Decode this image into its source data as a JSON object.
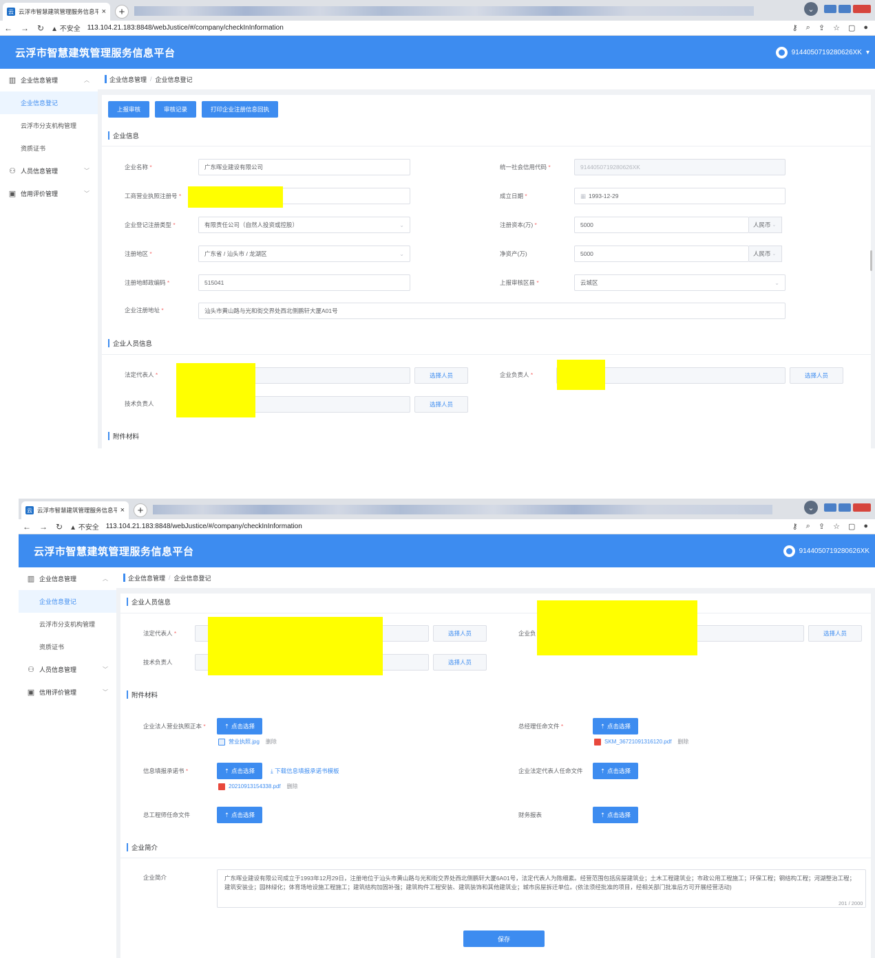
{
  "browser": {
    "tab_title": "云浮市智慧建筑管理服务信息平",
    "tab_close": "×",
    "new_tab": "+",
    "insecure": "▲ 不安全",
    "url": "113.104.21.183:8848/webJustice/#/company/checkInInformation"
  },
  "app": {
    "title": "云浮市智慧建筑管理服务信息平台",
    "user_id": "9144050719280626XK"
  },
  "sidebar": {
    "group_company": "企业信息管理",
    "item_register": "企业信息登记",
    "item_branch": "云浮市分支机构管理",
    "item_cert": "资质证书",
    "group_person": "人员信息管理",
    "group_credit": "信用评价管理"
  },
  "breadcrumb": {
    "parent": "企业信息管理",
    "current": "企业信息登记"
  },
  "actions": {
    "submit": "上报审核",
    "records": "审核记录",
    "print": "打印企业注册信息回执"
  },
  "sections": {
    "company_info": "企业信息",
    "personnel": "企业人员信息",
    "attachments": "附件材料",
    "intro": "企业简介"
  },
  "form": {
    "name_label": "企业名称",
    "name_value": "广东晖业建设有限公司",
    "credit_code_label": "统一社会信用代码",
    "credit_code_value": "9144050719280626XK",
    "license_label": "工商营业执照注册号",
    "found_date_label": "成立日期",
    "found_date_value": "1993-12-29",
    "reg_type_label": "企业登记注册类型",
    "reg_type_value": "有限责任公司（自然人投资或控股）",
    "capital_label": "注册资本(万)",
    "capital_value": "5000",
    "currency": "人民币",
    "region_label": "注册地区",
    "region_value": "广东省 / 汕头市 / 龙湖区",
    "net_assets_label": "净资产(万)",
    "net_assets_value": "5000",
    "postcode_label": "注册地邮政编码",
    "postcode_value": "515041",
    "review_district_label": "上报审核区县",
    "review_district_value": "云城区",
    "address_label": "企业注册地址",
    "address_value": "汕头市黄山路与光和街交界处西北侧鹏轩大厦A01号"
  },
  "personnel": {
    "legal_rep_label": "法定代表人",
    "company_head_label": "企业负责人",
    "company_head_label_partial": "企业负",
    "tech_head_label": "技术负责人",
    "select_btn": "选择人员"
  },
  "attachments": {
    "upload_btn": "点击选择",
    "license_copy_label": "企业法人营业执照正本",
    "license_copy_file": "营业执照.jpg",
    "gm_label": "总经理任命文件",
    "gm_file": "SKM_36721091316120.pdf",
    "pledge_label": "信息填报承诺书",
    "pledge_template": "下载信息填报承诺书模板",
    "pledge_file": "20210913154338.pdf",
    "legal_appoint_label": "企业法定代表人任命文件",
    "chief_eng_label": "总工程师任命文件",
    "finance_label": "财务报表",
    "delete": "删除"
  },
  "intro": {
    "label": "企业简介",
    "text": "广东晖业建设有限公司成立于1993年12月29日，注册地位于汕头市黄山路与光和街交界处西北侧鹏轩大厦6A01号，法定代表人为陈细素。经营范围包括房屋建筑业；土木工程建筑业；市政公用工程施工；环保工程；钢结构工程；河湖整治工程；建筑安装业；园林绿化；体育场地设施工程施工；建筑结构加固补强；建筑构件工程安装、建筑装饰和其他建筑业；城市房屋拆迁单位。(依法须经批准的项目，经相关部门批准后方可开展经营活动)",
    "counter": "201 / 2000"
  },
  "save": "保存",
  "colors": {
    "primary": "#3d8cf0",
    "redaction": "#ffff00",
    "required": "#f56c6c"
  }
}
